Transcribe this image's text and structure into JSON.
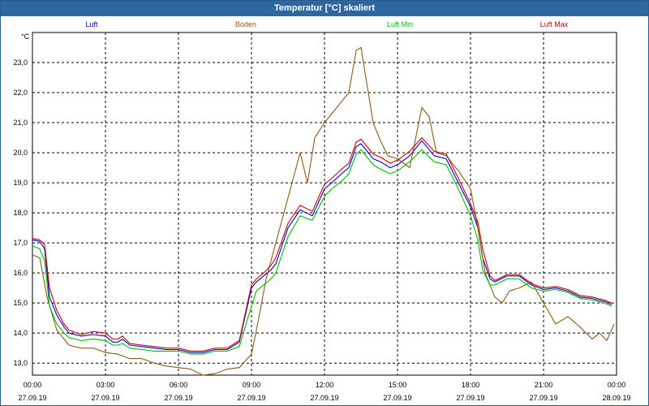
{
  "window": {
    "title": "Temperatur [°C] skaliert"
  },
  "chart_data": {
    "type": "line",
    "title": "Temperatur [°C] skaliert",
    "ylabel": "°C",
    "xlabel": "",
    "ylim": [
      12.6,
      24.0
    ],
    "y_ticks": [
      "13,0",
      "14,0",
      "15,0",
      "16,0",
      "17,0",
      "18,0",
      "19,0",
      "20,0",
      "21,0",
      "22,0",
      "23,0"
    ],
    "x_range_hours": [
      0,
      24
    ],
    "x_ticks": [
      {
        "time": "00:00",
        "date": "27.09.19"
      },
      {
        "time": "03:00",
        "date": "27.09.19"
      },
      {
        "time": "06:00",
        "date": "27.09.19"
      },
      {
        "time": "09:00",
        "date": "27.09.19"
      },
      {
        "time": "12:00",
        "date": "27.09.19"
      },
      {
        "time": "15:00",
        "date": "27.09.19"
      },
      {
        "time": "18:00",
        "date": "27.09.19"
      },
      {
        "time": "21:00",
        "date": "27.09.19"
      },
      {
        "time": "00:00",
        "date": "28.09.19"
      }
    ],
    "grid": true,
    "legend_position": "top",
    "series": [
      {
        "name": "Luft",
        "color": "#0000cc",
        "x": [
          0,
          0.3,
          0.5,
          0.7,
          1,
          1.3,
          1.5,
          2,
          2.5,
          3,
          3.3,
          3.5,
          3.7,
          4,
          4.5,
          5,
          5.5,
          6,
          6.5,
          7,
          7.5,
          8,
          8.5,
          9,
          9.2,
          9.5,
          9.8,
          10,
          10.5,
          11,
          11.5,
          12,
          12.3,
          12.7,
          13,
          13.3,
          13.5,
          14,
          14.3,
          14.7,
          15,
          15.5,
          16,
          16.5,
          17,
          17.5,
          18,
          18.3,
          18.5,
          18.8,
          19,
          19.5,
          20,
          20.5,
          21,
          21.5,
          22,
          22.5,
          23,
          23.5,
          23.8
        ],
        "y": [
          17.1,
          17.05,
          16.8,
          15.2,
          14.6,
          14.2,
          14.0,
          13.9,
          13.95,
          13.9,
          13.7,
          13.7,
          13.8,
          13.6,
          13.55,
          13.5,
          13.45,
          13.45,
          13.35,
          13.35,
          13.45,
          13.45,
          13.7,
          15.5,
          15.7,
          15.9,
          16.1,
          16.3,
          17.5,
          18.1,
          17.9,
          18.8,
          19.0,
          19.3,
          19.5,
          20.2,
          20.3,
          19.8,
          19.7,
          19.5,
          19.6,
          19.9,
          20.4,
          19.9,
          19.8,
          19.0,
          18.2,
          17.5,
          16.5,
          15.8,
          15.7,
          15.9,
          15.9,
          15.6,
          15.45,
          15.5,
          15.4,
          15.2,
          15.15,
          15.05,
          14.95
        ]
      },
      {
        "name": "Boden",
        "color": "#8b5a1a",
        "x": [
          0,
          0.3,
          0.6,
          1,
          1.5,
          2,
          2.5,
          3,
          3.5,
          4,
          4.5,
          5,
          5.5,
          6,
          6.5,
          7,
          7.5,
          8,
          8.5,
          9,
          9.3,
          9.6,
          10,
          10.5,
          11,
          11.3,
          11.6,
          12,
          12.5,
          13,
          13.3,
          13.5,
          13.8,
          14,
          14.3,
          14.6,
          15,
          15.5,
          16,
          16.3,
          16.6,
          17,
          17.5,
          18,
          18.3,
          18.6,
          19,
          19.3,
          19.6,
          20,
          20.5,
          21,
          21.5,
          22,
          22.5,
          23,
          23.3,
          23.6,
          23.9
        ],
        "y": [
          16.6,
          16.5,
          15.2,
          14.1,
          13.6,
          13.5,
          13.5,
          13.35,
          13.3,
          13.15,
          13.15,
          13.0,
          12.9,
          12.85,
          12.8,
          12.6,
          12.65,
          12.8,
          12.85,
          13.3,
          14.5,
          15.8,
          17.0,
          18.5,
          20.0,
          19.0,
          20.5,
          21.0,
          21.5,
          22.0,
          23.4,
          23.5,
          22.0,
          21.0,
          20.4,
          19.9,
          19.8,
          19.5,
          21.5,
          21.2,
          20.0,
          19.9,
          19.4,
          18.8,
          17.5,
          16.0,
          15.2,
          15.0,
          15.4,
          15.5,
          15.7,
          15.0,
          14.3,
          14.55,
          14.2,
          13.8,
          14.0,
          13.75,
          14.3
        ]
      },
      {
        "name": "Luft Min",
        "color": "#00bb00",
        "x": [
          0,
          0.3,
          0.5,
          0.7,
          1,
          1.3,
          1.5,
          2,
          2.5,
          3,
          3.3,
          3.5,
          3.7,
          4,
          4.5,
          5,
          5.5,
          6,
          6.5,
          7,
          7.5,
          8,
          8.5,
          9,
          9.2,
          9.5,
          9.8,
          10,
          10.5,
          11,
          11.5,
          12,
          12.3,
          12.7,
          13,
          13.3,
          13.5,
          14,
          14.3,
          14.7,
          15,
          15.5,
          16,
          16.5,
          17,
          17.5,
          18,
          18.3,
          18.5,
          18.8,
          19,
          19.5,
          20,
          20.5,
          21,
          21.5,
          22,
          22.5,
          23,
          23.5,
          23.8
        ],
        "y": [
          16.9,
          16.8,
          16.4,
          14.9,
          14.3,
          14.0,
          13.85,
          13.75,
          13.8,
          13.75,
          13.6,
          13.6,
          13.65,
          13.5,
          13.45,
          13.4,
          13.4,
          13.4,
          13.3,
          13.3,
          13.4,
          13.4,
          13.55,
          14.9,
          15.4,
          15.6,
          15.8,
          16.0,
          17.2,
          17.9,
          17.75,
          18.55,
          18.8,
          19.05,
          19.3,
          19.95,
          20.1,
          19.6,
          19.45,
          19.3,
          19.4,
          19.7,
          20.1,
          19.7,
          19.6,
          18.8,
          17.9,
          17.1,
          16.1,
          15.6,
          15.6,
          15.8,
          15.8,
          15.5,
          15.4,
          15.45,
          15.35,
          15.15,
          15.1,
          15.0,
          14.9
        ]
      },
      {
        "name": "Luft Max",
        "color": "#cc0000",
        "x": [
          0,
          0.3,
          0.5,
          0.7,
          1,
          1.3,
          1.5,
          2,
          2.5,
          3,
          3.3,
          3.5,
          3.7,
          4,
          4.5,
          5,
          5.5,
          6,
          6.5,
          7,
          7.5,
          8,
          8.5,
          9,
          9.2,
          9.5,
          9.8,
          10,
          10.5,
          11,
          11.5,
          12,
          12.3,
          12.7,
          13,
          13.3,
          13.5,
          14,
          14.3,
          14.7,
          15,
          15.5,
          16,
          16.5,
          17,
          17.5,
          18,
          18.3,
          18.5,
          18.8,
          19,
          19.5,
          20,
          20.5,
          21,
          21.5,
          22,
          22.5,
          23,
          23.5,
          23.8
        ],
        "y": [
          17.15,
          17.1,
          16.95,
          15.5,
          14.75,
          14.3,
          14.1,
          13.95,
          14.05,
          14.0,
          13.8,
          13.8,
          13.9,
          13.65,
          13.6,
          13.55,
          13.5,
          13.5,
          13.4,
          13.4,
          13.5,
          13.5,
          13.75,
          15.6,
          15.8,
          16.0,
          16.25,
          16.5,
          17.65,
          18.25,
          18.05,
          18.95,
          19.15,
          19.45,
          19.65,
          20.35,
          20.45,
          19.95,
          19.85,
          19.65,
          19.75,
          20.05,
          20.5,
          20.05,
          19.95,
          19.15,
          18.3,
          17.7,
          16.8,
          15.9,
          15.75,
          15.95,
          15.95,
          15.65,
          15.5,
          15.55,
          15.45,
          15.25,
          15.2,
          15.1,
          15.0
        ]
      }
    ]
  }
}
